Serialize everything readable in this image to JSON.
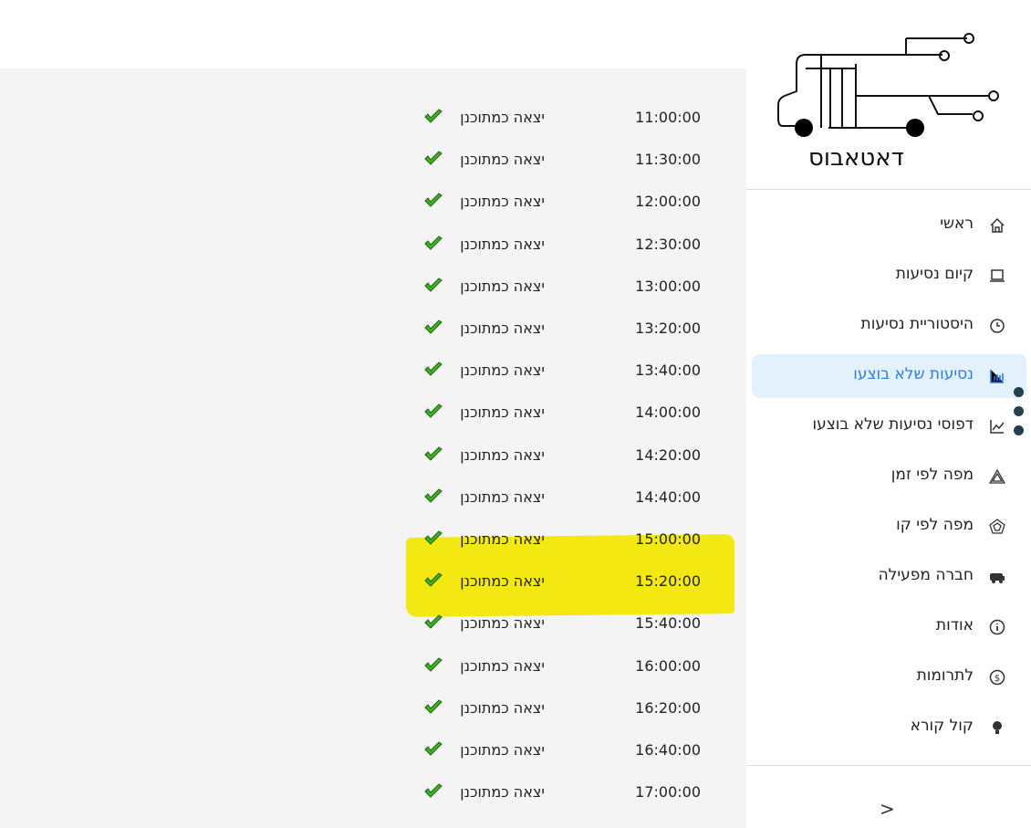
{
  "brand": {
    "name": "דאטאבוס"
  },
  "sidebar": {
    "items": [
      {
        "label": "ראשי",
        "icon": "home-icon"
      },
      {
        "label": "קיום נסיעות",
        "icon": "laptop-icon"
      },
      {
        "label": "היסטוריית נסיעות",
        "icon": "clock-history-icon"
      },
      {
        "label": "נסיעות שלא בוצעו",
        "icon": "bar-chart-icon",
        "active": true
      },
      {
        "label": "דפוסי נסיעות שלא בוצעו",
        "icon": "line-chart-icon"
      },
      {
        "label": "מפה לפי זמן",
        "icon": "triangle-map-icon"
      },
      {
        "label": "מפה לפי קו",
        "icon": "pentagon-map-icon"
      },
      {
        "label": "חברה מפעילה",
        "icon": "bus-icon"
      },
      {
        "label": "אודות",
        "icon": "info-icon"
      },
      {
        "label": "לתרומות",
        "icon": "dollar-icon"
      },
      {
        "label": "קול קורא",
        "icon": "lightbulb-icon"
      }
    ],
    "collapse": ">"
  },
  "rides": [
    {
      "time": "11:00:00",
      "status": "יצאה כמתוכנן"
    },
    {
      "time": "11:30:00",
      "status": "יצאה כמתוכנן"
    },
    {
      "time": "12:00:00",
      "status": "יצאה כמתוכנן"
    },
    {
      "time": "12:30:00",
      "status": "יצאה כמתוכנן"
    },
    {
      "time": "13:00:00",
      "status": "יצאה כמתוכנן"
    },
    {
      "time": "13:20:00",
      "status": "יצאה כמתוכנן"
    },
    {
      "time": "13:40:00",
      "status": "יצאה כמתוכנן"
    },
    {
      "time": "14:00:00",
      "status": "יצאה כמתוכנן"
    },
    {
      "time": "14:20:00",
      "status": "יצאה כמתוכנן"
    },
    {
      "time": "14:40:00",
      "status": "יצאה כמתוכנן"
    },
    {
      "time": "15:00:00",
      "status": "יצאה כמתוכנן"
    },
    {
      "time": "15:20:00",
      "status": "יצאה כמתוכנן"
    },
    {
      "time": "15:40:00",
      "status": "יצאה כמתוכנן"
    },
    {
      "time": "16:00:00",
      "status": "יצאה כמתוכנן"
    },
    {
      "time": "16:20:00",
      "status": "יצאה כמתוכנן"
    },
    {
      "time": "16:40:00",
      "status": "יצאה כמתוכנן"
    },
    {
      "time": "17:00:00",
      "status": "יצאה כמתוכנן"
    }
  ],
  "colors": {
    "check": "#3cb521",
    "active": "#2b7de9",
    "highlight": "#f2e600"
  }
}
